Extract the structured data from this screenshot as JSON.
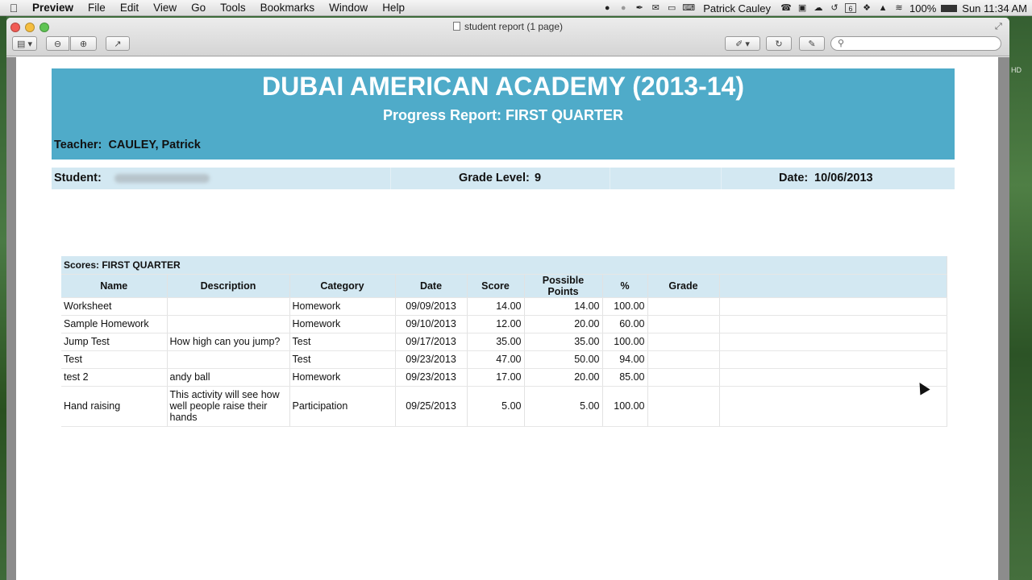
{
  "menubar": {
    "app": "Preview",
    "items": [
      "File",
      "Edit",
      "View",
      "Go",
      "Tools",
      "Bookmarks",
      "Window",
      "Help"
    ],
    "user": "Patrick Cauley",
    "battery": "100%",
    "clock": "Sun 11:34 AM",
    "calendar_day": "6"
  },
  "window": {
    "title": "student report (1 page)"
  },
  "document": {
    "school": "DUBAI AMERICAN ACADEMY (2013-14)",
    "report_title": "Progress Report: FIRST QUARTER",
    "teacher_label": "Teacher:",
    "teacher_name": "CAULEY, Patrick",
    "student_label": "Student:",
    "grade_level_label": "Grade Level:",
    "grade_level": "9",
    "date_label": "Date:",
    "date": "10/06/2013",
    "colors": {
      "banner": "#4fabc9",
      "header_band": "#d3e8f2"
    }
  },
  "scores": {
    "section_title": "Scores: FIRST QUARTER",
    "columns": [
      "Name",
      "Description",
      "Category",
      "Date",
      "Score",
      "Possible Points",
      "%",
      "Grade",
      ""
    ],
    "rows": [
      {
        "name": "Worksheet",
        "description": "",
        "category": "Homework",
        "date": "09/09/2013",
        "score": "14.00",
        "possible": "14.00",
        "pct": "100.00",
        "grade": ""
      },
      {
        "name": "Sample Homework",
        "description": "",
        "category": "Homework",
        "date": "09/10/2013",
        "score": "12.00",
        "possible": "20.00",
        "pct": "60.00",
        "grade": ""
      },
      {
        "name": "Jump Test",
        "description": "How high can you jump?",
        "category": "Test",
        "date": "09/17/2013",
        "score": "35.00",
        "possible": "35.00",
        "pct": "100.00",
        "grade": ""
      },
      {
        "name": "Test",
        "description": "",
        "category": "Test",
        "date": "09/23/2013",
        "score": "47.00",
        "possible": "50.00",
        "pct": "94.00",
        "grade": ""
      },
      {
        "name": "test 2",
        "description": "andy ball",
        "category": "Homework",
        "date": "09/23/2013",
        "score": "17.00",
        "possible": "20.00",
        "pct": "85.00",
        "grade": ""
      },
      {
        "name": "Hand raising",
        "description": "This activity will see how well people raise their hands",
        "category": "Participation",
        "date": "09/25/2013",
        "score": "5.00",
        "possible": "5.00",
        "pct": "100.00",
        "grade": ""
      }
    ]
  },
  "icons": [
    "apple-icon",
    "sidebar-icon",
    "zoom-out-icon",
    "zoom-in-icon",
    "share-icon",
    "pen-icon",
    "rotate-icon",
    "edit-icon",
    "search-icon",
    "wifi-icon",
    "cursor-icon"
  ]
}
